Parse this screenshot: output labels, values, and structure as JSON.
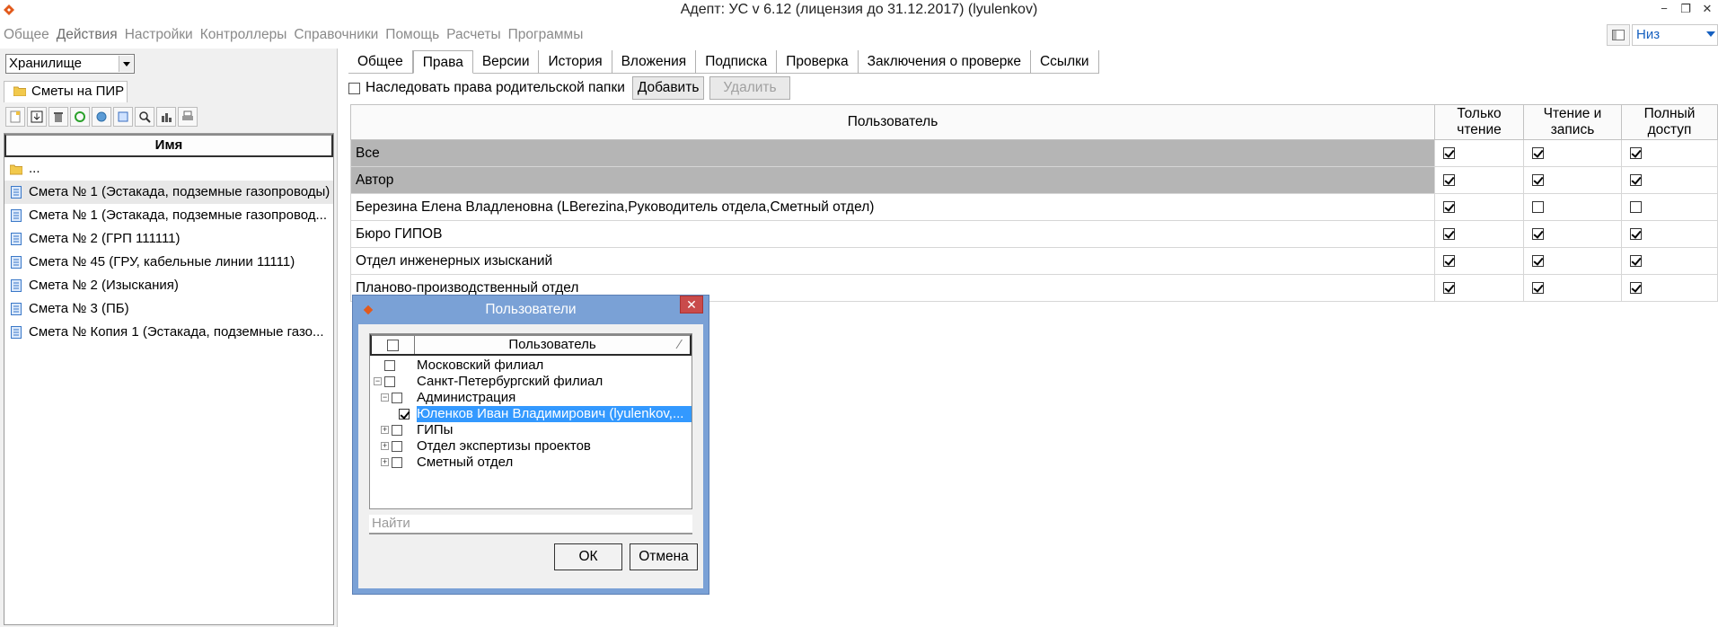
{
  "title": "Адепт: УС  v 6.12 (лицензия до 31.12.2017) (lyulenkov)",
  "menu": [
    "Общее",
    "Действия",
    "Настройки",
    "Контроллеры",
    "Справочники",
    "Помощь",
    "Расчеты",
    "Программы"
  ],
  "direction": "Низ",
  "storage": "Хранилище",
  "folder_tab": "Сметы на ПИР",
  "file_list": {
    "header": "Имя",
    "items": [
      "...",
      "Смета № 1 (Эстакада, подземные газопроводы)",
      "Смета № 1 (Эстакада, подземные газопровод...",
      "Смета № 2 (ГРП 111111)",
      "Смета № 45 (ГРУ, кабельные линии 11111)",
      "Смета № 2 (Изыскания)",
      "Смета № 3 (ПБ)",
      "Смета № Копия 1 (Эстакада, подземные газо..."
    ]
  },
  "tabs": [
    "Общее",
    "Права",
    "Версии",
    "История",
    "Вложения",
    "Подписка",
    "Проверка",
    "Заключения о проверке",
    "Ссылки"
  ],
  "active_tab": "Права",
  "inherit_label": "Наследовать права родительской папки",
  "add_button": "Добавить",
  "delete_button": "Удалить",
  "perm_table": {
    "headers": [
      "Пользователь",
      "Только чтение",
      "Чтение и запись",
      "Полный доступ"
    ],
    "rows": [
      {
        "user": "Все",
        "read": true,
        "write": true,
        "full": true,
        "grey": true
      },
      {
        "user": "Автор",
        "read": true,
        "write": true,
        "full": true,
        "grey": true
      },
      {
        "user": "Березина Елена Владленовна (LBerezina,Руководитель отдела,Сметный отдел)",
        "read": true,
        "write": false,
        "full": false,
        "grey": false
      },
      {
        "user": "Бюро ГИПОВ",
        "read": true,
        "write": true,
        "full": true,
        "grey": false
      },
      {
        "user": "Отдел инженерных изысканий",
        "read": true,
        "write": true,
        "full": true,
        "grey": false
      },
      {
        "user": "Планово-производственный отдел",
        "read": true,
        "write": true,
        "full": true,
        "grey": false
      }
    ]
  },
  "dialog": {
    "title": "Пользователи",
    "column": "Пользователь",
    "tree": [
      {
        "label": "Московский филиал",
        "level": 0,
        "expander": "",
        "checked": false
      },
      {
        "label": "Санкт-Петербургский филиал",
        "level": 0,
        "expander": "−",
        "checked": false
      },
      {
        "label": "Администрация",
        "level": 1,
        "expander": "−",
        "checked": false
      },
      {
        "label": "Юленков Иван Владимирович (lyulenkov,...",
        "level": 2,
        "expander": "",
        "checked": true,
        "selected": true
      },
      {
        "label": "ГИПы",
        "level": 1,
        "expander": "+",
        "checked": false
      },
      {
        "label": "Отдел экспертизы проектов",
        "level": 1,
        "expander": "+",
        "checked": false
      },
      {
        "label": "Сметный отдел",
        "level": 1,
        "expander": "+",
        "checked": false
      }
    ],
    "find_placeholder": "Найти",
    "ok": "ОК",
    "cancel": "Отмена"
  }
}
